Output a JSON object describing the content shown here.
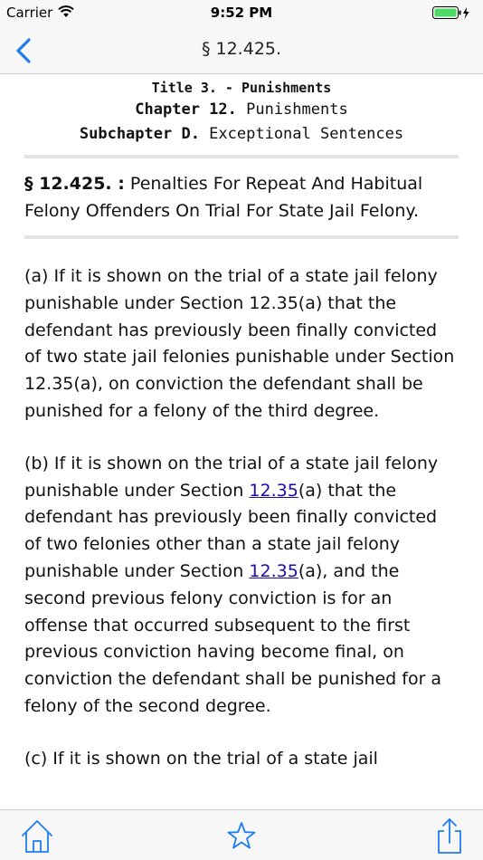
{
  "status": {
    "carrier": "Carrier",
    "time": "9:52 PM"
  },
  "nav": {
    "title": "§ 12.425."
  },
  "header": {
    "title_label": "Title 3.",
    "title_sep": " - ",
    "title_name": "Punishments",
    "chapter_label": "Chapter 12.",
    "chapter_name": " Punishments",
    "subchapter_label": "Subchapter D.",
    "subchapter_name": " Exceptional Sentences"
  },
  "section": {
    "number": "§ 12.425. :",
    "title": " Penalties For Repeat And Habitual Felony Offenders On Trial For State Jail Felony."
  },
  "paragraphs": {
    "a": "(a) If it is shown on the trial of a state jail felony punishable under Section 12.35(a) that the defendant has previously been finally convicted of two state jail felonies punishable under Section 12.35(a), on conviction the defendant shall be punished for a felony of the third degree.",
    "b_1": "(b) If it is shown on the trial of a state jail felony punishable under Section ",
    "b_link1": "12.35",
    "b_2": "(a) that the defendant has previously been finally convicted of two felonies other than a state jail felony punishable under Section ",
    "b_link2": "12.35",
    "b_3": "(a), and the second previous felony conviction is for an offense that occurred subsequent to the first previous conviction having become final, on conviction the defendant shall be punished for a felony of the second degree.",
    "c": "(c) If it is shown on the trial of a state jail"
  },
  "colors": {
    "accent": "#1e7cf2",
    "link": "#1a0dab",
    "battery": "#4cd964"
  },
  "icons": {
    "back": "chevron-left-icon",
    "home": "home-icon",
    "favorite": "star-icon",
    "share": "share-icon"
  }
}
